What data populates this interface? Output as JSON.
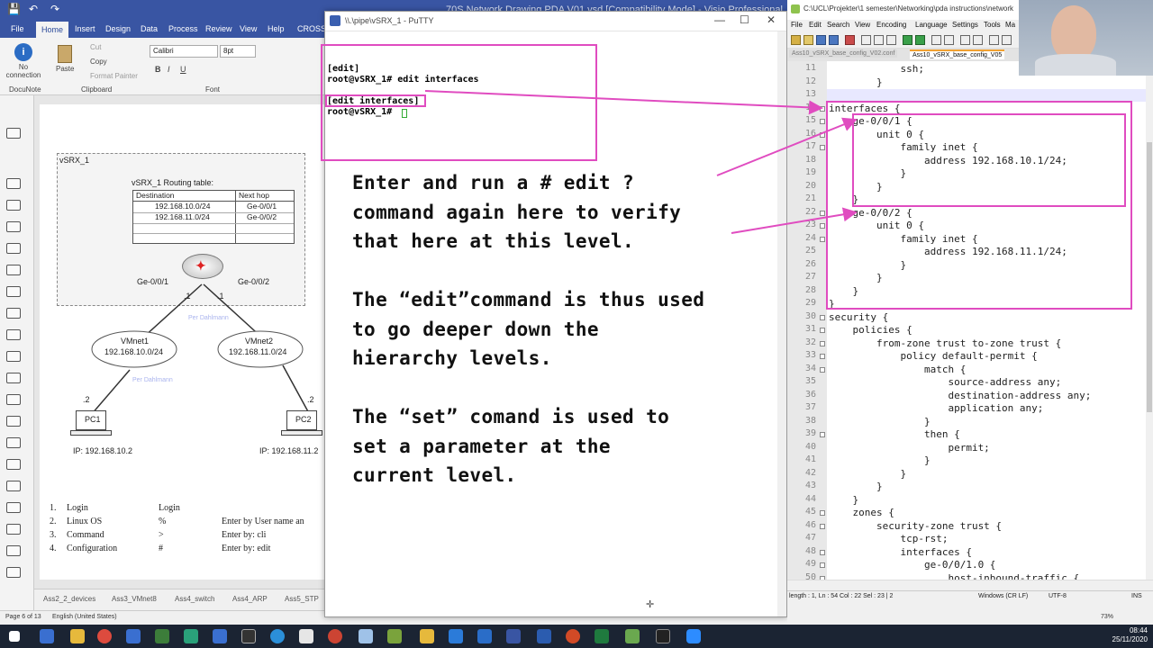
{
  "visio": {
    "title": "70S Network Drawing PDA V01.vsd  [Compatibility Mode] - Visio Professional",
    "tabs": [
      "File",
      "Home",
      "Insert",
      "Design",
      "Data",
      "Process",
      "Review",
      "View",
      "Help",
      "CROSS-F"
    ],
    "ribbon": {
      "docunote": "DocuNote",
      "no_connection": "No\nconnection",
      "paste": "Paste",
      "cut": "Cut",
      "copy": "Copy",
      "format_painter": "Format Painter",
      "clipboard": "Clipboard",
      "font": "Calibri",
      "font_size": "8pt",
      "font_group": "Font"
    },
    "diagram": {
      "container": "vSRX_1",
      "routing_title": "vSRX_1 Routing table:",
      "table_headers": [
        "Destination",
        "Next hop"
      ],
      "table_rows": [
        [
          "192.168.10.0/24",
          "Ge-0/0/1"
        ],
        [
          "192.168.11.0/24",
          "Ge-0/0/2"
        ]
      ],
      "ge1": "Ge-0/0/1",
      "ge2": "Ge-0/0/2",
      "dot1a": ".1",
      "dot1b": ".1",
      "vmnet1": "VMnet1",
      "vmnet1_net": "192.168.10.0/24",
      "vmnet2": "VMnet2",
      "vmnet2_net": "192.168.11.0/24",
      "dot2a": ".2",
      "dot2b": ".2",
      "pc1": "PC1",
      "pc2": "PC2",
      "pc1_ip": "IP: 192.168.10.2",
      "pc2_ip": "IP: 192.168.11.2",
      "watermark1": "Per Dahlmann",
      "watermark2": "Per Dahlmann"
    },
    "steps": [
      {
        "n": "1.",
        "name": "Login",
        "prompt": "Login",
        "note": ""
      },
      {
        "n": "2.",
        "name": "Linux OS",
        "prompt": "%",
        "note": "Enter by User name an"
      },
      {
        "n": "3.",
        "name": "Command",
        "prompt": ">",
        "note": "Enter by: cli"
      },
      {
        "n": "4.",
        "name": "Configuration",
        "prompt": "#",
        "note": "Enter by: edit"
      }
    ],
    "page_tabs": [
      "Ass2_2_devices",
      "Ass3_VMnet8",
      "Ass4_switch",
      "Ass4_ARP",
      "Ass5_STP"
    ],
    "status": {
      "page": "Page 6 of 13",
      "lang": "English (United States)"
    }
  },
  "putty": {
    "title": "\\\\.\\pipe\\vSRX_1 - PuTTY",
    "lines": [
      "[edit]",
      "root@vSRX_1# edit interfaces",
      "",
      "[edit interfaces]",
      "root@vSRX_1# "
    ],
    "annotation": [
      "Enter and run a # edit ?",
      "command again here to verify",
      "that here at this level.",
      "",
      "The “edit”command is thus used",
      "to go deeper down the",
      "hierarchy levels.",
      "",
      "The “set” comand is used to",
      "set a parameter at the",
      "current level."
    ]
  },
  "npp": {
    "title": "C:\\UCL\\Projekter\\1 semester\\Networking\\pda instructions\\network",
    "menu": [
      "File",
      "Edit",
      "Search",
      "View",
      "Encoding",
      "Language",
      "Settings",
      "Tools",
      "Ma"
    ],
    "tabs": [
      "Ass10_vSRX_base_config_V02.conf",
      "Ass10_vSRX_base_config_V05"
    ],
    "line_numbers": [
      11,
      12,
      13,
      14,
      15,
      16,
      17,
      18,
      19,
      20,
      21,
      22,
      23,
      24,
      25,
      26,
      27,
      28,
      29,
      30,
      31,
      32,
      33,
      34,
      35,
      36,
      37,
      38,
      39,
      40,
      41,
      42,
      43,
      44,
      45,
      46,
      47,
      48,
      49,
      50
    ],
    "code": [
      "            ssh;",
      "        }",
      "    }",
      "interfaces {",
      "    ge-0/0/1 {",
      "        unit 0 {",
      "            family inet {",
      "                address 192.168.10.1/24;",
      "            }",
      "        }",
      "    }",
      "    ge-0/0/2 {",
      "        unit 0 {",
      "            family inet {",
      "                address 192.168.11.1/24;",
      "            }",
      "        }",
      "    }",
      "}",
      "security {",
      "    policies {",
      "        from-zone trust to-zone trust {",
      "            policy default-permit {",
      "                match {",
      "                    source-address any;",
      "                    destination-address any;",
      "                    application any;",
      "                }",
      "                then {",
      "                    permit;",
      "                }",
      "            }",
      "        }",
      "    }",
      "    zones {",
      "        security-zone trust {",
      "            tcp-rst;",
      "            interfaces {",
      "                ge-0/0/1.0 {",
      "                    host-inbound-traffic {"
    ],
    "status": {
      "pos": "length : 1,  Ln : 54   Col : 22   Sel : 23 | 2",
      "eol": "Windows (CR LF)",
      "enc": "UTF-8",
      "mode": "INS"
    }
  },
  "taskbar": {
    "time": "08:44",
    "date": "25/11/2020",
    "zoom": "73%"
  },
  "colors": {
    "highlight": "#e04cc0",
    "number": "#e09b2b",
    "title_blue": "#3955a3"
  }
}
